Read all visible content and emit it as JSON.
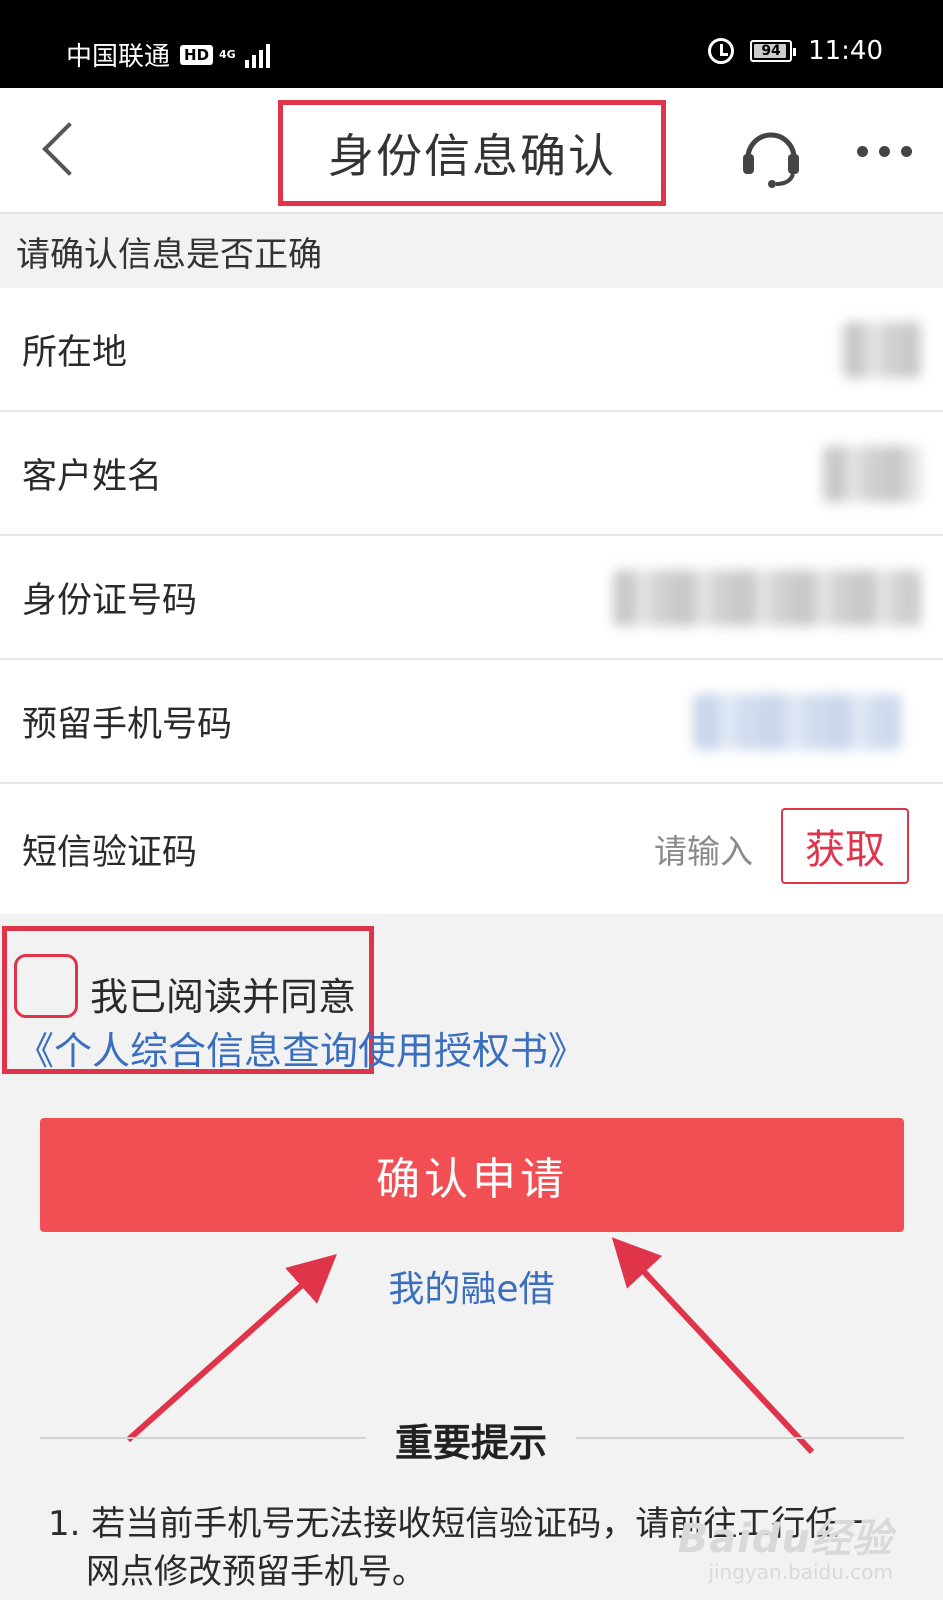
{
  "status_bar": {
    "carrier": "中国联通",
    "hd": "HD",
    "network": "4G",
    "battery": "94",
    "battery_level": 0.94,
    "time": "11:40"
  },
  "nav": {
    "title": "身份信息确认"
  },
  "section": {
    "header": "请确认信息是否正确"
  },
  "info_rows": [
    {
      "label": "所在地"
    },
    {
      "label": "客户姓名"
    },
    {
      "label": "身份证号码"
    },
    {
      "label": "预留手机号码"
    },
    {
      "label": "短信验证码"
    }
  ],
  "sms": {
    "placeholder": "请输入",
    "get_code_label": "获取"
  },
  "agreement": {
    "text": "我已阅读并同意",
    "link": "《个人综合信息查询使用授权书》"
  },
  "actions": {
    "confirm_label": "确认申请",
    "my_loan_link": "我的融e借"
  },
  "notice": {
    "title": "重要提示",
    "items": [
      "1. 若当前手机号无法接收短信验证码，请前往工行任一网点修改预留手机号。"
    ]
  },
  "watermark": {
    "main": "Baidu经验",
    "sub": "jingyan.baidu.com"
  },
  "colors": {
    "accent_red": "#f24f54",
    "highlight_red": "#e0344a",
    "link_blue": "#3a6fbf"
  }
}
